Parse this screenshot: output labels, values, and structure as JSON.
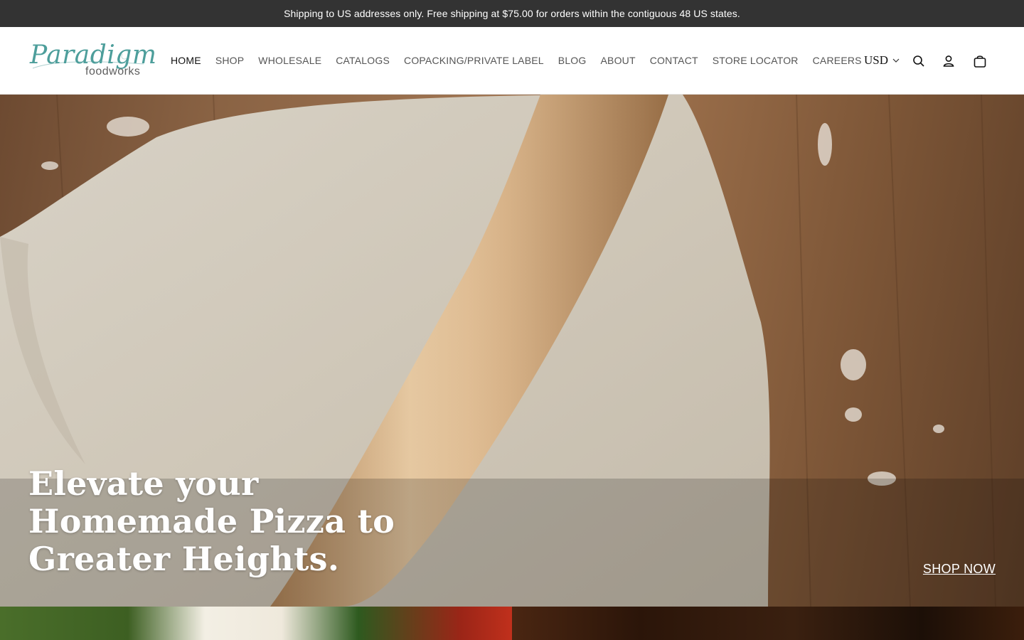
{
  "announcement": {
    "text": "Shipping to US addresses only. Free shipping at $75.00 for orders within the contiguous 48 US states."
  },
  "header": {
    "logo": {
      "script": "Paradigm",
      "sub": "foodworks",
      "icon": "paradigm-foodworks-logo"
    },
    "nav": [
      {
        "label": "HOME",
        "active": true
      },
      {
        "label": "SHOP"
      },
      {
        "label": "WHOLESALE"
      },
      {
        "label": "CATALOGS"
      },
      {
        "label": "COPACKING/PRIVATE LABEL"
      },
      {
        "label": "BLOG"
      },
      {
        "label": "ABOUT"
      },
      {
        "label": "CONTACT"
      },
      {
        "label": "STORE LOCATOR"
      },
      {
        "label": "CAREERS"
      }
    ],
    "currency": {
      "selected": "USD",
      "icon": "chevron-down-icon"
    },
    "icons": {
      "search": "search-icon",
      "account": "user-icon",
      "cart": "shopping-bag-icon"
    }
  },
  "hero": {
    "heading": "Elevate your Homemade Pizza to Greater Heights.",
    "cta": "SHOP NOW",
    "image": "pizza dough rolled with a wooden rolling pin on a floured wooden board"
  },
  "tiles": [
    {
      "image": "caprese salad with tomato, mozzarella and basil"
    },
    {
      "image": "dark kitchen scene"
    }
  ],
  "colors": {
    "announcement_bg": "#333333",
    "logo_teal": "#4d9e9b",
    "text_dark": "#111111",
    "nav_text": "#555555"
  }
}
